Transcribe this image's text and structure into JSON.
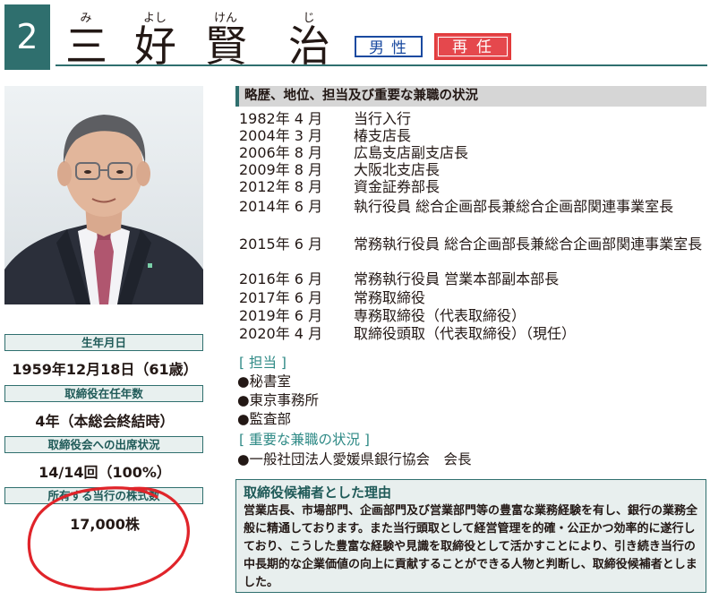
{
  "candidate": {
    "number": "2",
    "name_chars": [
      "三",
      "好",
      "賢",
      "治"
    ],
    "ruby": [
      "み",
      "よし",
      "けん",
      "じ"
    ],
    "gender_badge": "男性",
    "status_badge": "再任"
  },
  "profile": {
    "birth_label": "生年月日",
    "birth_value": "1959年12月18日（61歳）",
    "tenure_label": "取締役在任年数",
    "tenure_value": "4年（本総会終結時）",
    "attendance_label": "取締役会への出席状況",
    "attendance_value": "14/14回（100%）",
    "shares_label": "所有する当行の株式数",
    "shares_value": "17,000株"
  },
  "career": {
    "heading": "略歴、地位、担当及び重要な兼職の状況",
    "history": [
      {
        "date": "1982年 4 月",
        "desc": "当行入行"
      },
      {
        "date": "2004年 3 月",
        "desc": "椿支店長"
      },
      {
        "date": "2006年 8 月",
        "desc": "広島支店副支店長"
      },
      {
        "date": "2009年 8 月",
        "desc": "大阪北支店長"
      },
      {
        "date": "2012年 8 月",
        "desc": "資金証券部長"
      },
      {
        "date": "2014年 6 月",
        "desc": "執行役員 総合企画部長兼総合企画部関連事業室長"
      },
      {
        "date": "2015年 6 月",
        "desc": "常務執行役員 総合企画部長兼総合企画部関連事業室長"
      },
      {
        "date": "2016年 6 月",
        "desc": "常務執行役員 営業本部副本部長"
      },
      {
        "date": "2017年 6 月",
        "desc": "常務取締役"
      },
      {
        "date": "2019年 6 月",
        "desc": "専務取締役（代表取締役）"
      },
      {
        "date": "2020年 4 月",
        "desc": "取締役頭取（代表取締役）（現任）"
      }
    ],
    "duties_heading": "[ 担当 ]",
    "duties": [
      "●秘書室",
      "●東京事務所",
      "●監査部"
    ],
    "concurrent_heading": "[ 重要な兼職の状況 ]",
    "concurrent": [
      "●一般社団法人愛媛県銀行協会　会長"
    ]
  },
  "reason": {
    "title": "取締役候補者とした理由",
    "text": "営業店長、市場部門、企画部門及び営業部門等の豊富な業務経験を有し、銀行の業務全般に精通しております。また当行頭取として経営管理を的確・公正かつ効率的に遂行しており、こうした豊富な経験や見識を取締役として活かすことにより、引き続き当行の中長期的な企業価値の向上に貢献することができる人物と判断し、取締役候補者としました。"
  },
  "colors": {
    "accent": "#2f6f6e",
    "badge_blue": "#1a4aa0",
    "badge_red": "#e5484d",
    "annotation_red": "#e0242a"
  }
}
